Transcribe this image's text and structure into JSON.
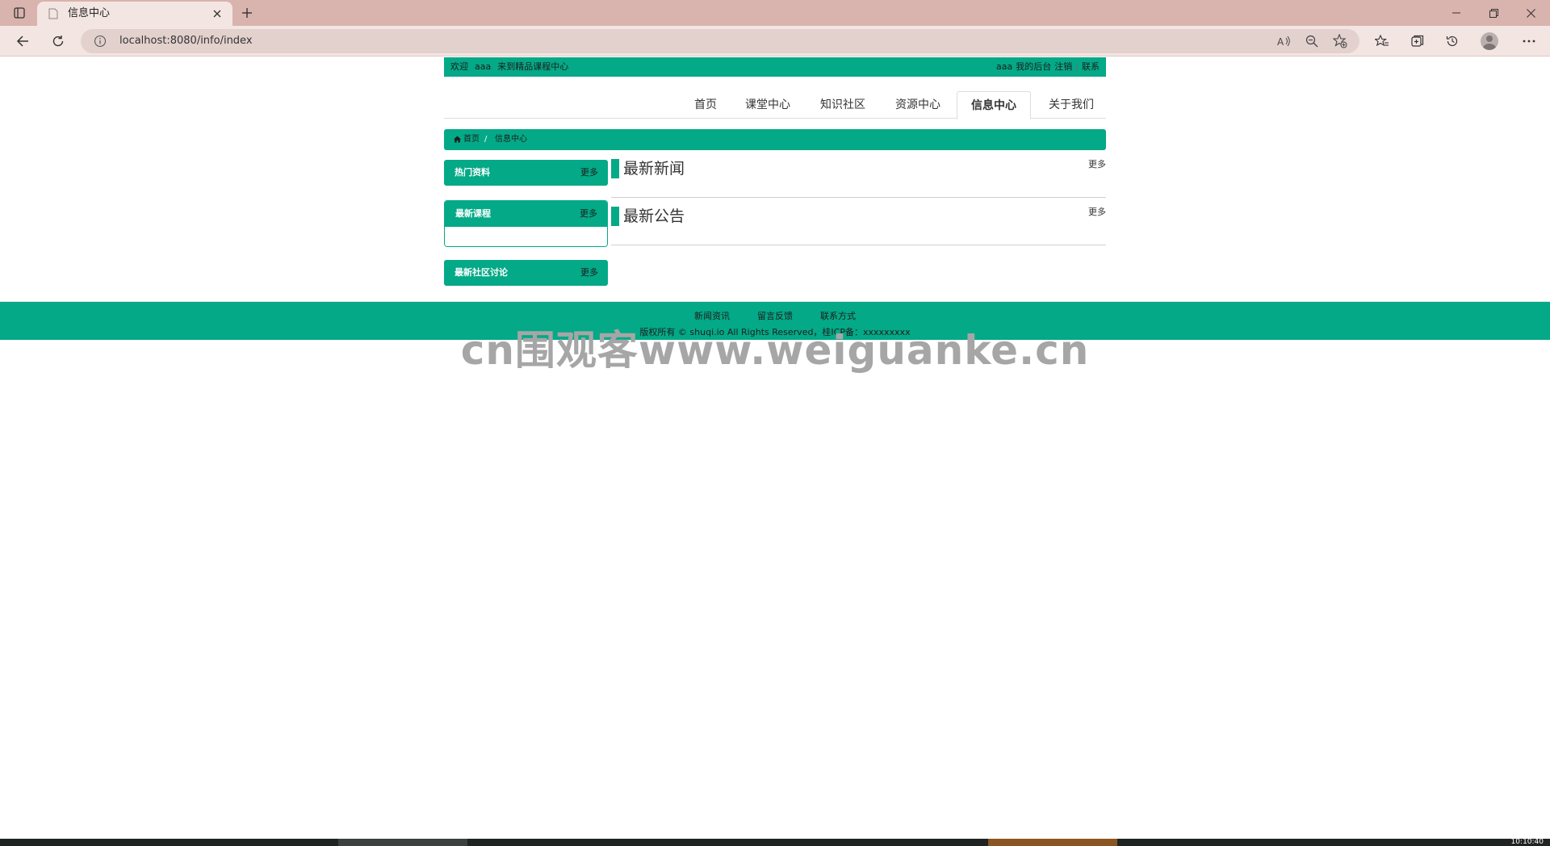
{
  "browser": {
    "tab_title": "信息中心",
    "url": "localhost:8080/info/index"
  },
  "colors": {
    "accent": "#04a987",
    "tabbar": "#d9b3ad",
    "toolbar": "#f3e5e2"
  },
  "topbar": {
    "welcome": "欢迎",
    "username": "aaa",
    "site_greeting": "来到精品课程中心",
    "right_user": "aaa",
    "backend_link": "我的后台",
    "logout_link": "注销",
    "contact_link": "联系"
  },
  "nav": {
    "items": [
      {
        "label": "首页",
        "active": false
      },
      {
        "label": "课堂中心",
        "active": false
      },
      {
        "label": "知识社区",
        "active": false
      },
      {
        "label": "资源中心",
        "active": false
      },
      {
        "label": "信息中心",
        "active": true
      },
      {
        "label": "关于我们",
        "active": false
      }
    ]
  },
  "breadcrumb": {
    "home": "首页",
    "separator": "/",
    "current": "信息中心"
  },
  "sidebar": {
    "panels": [
      {
        "title": "热门资料",
        "more": "更多"
      },
      {
        "title": "最新课程",
        "more": "更多"
      },
      {
        "title": "最新社区讨论",
        "more": "更多"
      }
    ]
  },
  "main": {
    "sections": [
      {
        "title": "最新新闻",
        "more": "更多"
      },
      {
        "title": "最新公告",
        "more": "更多"
      }
    ]
  },
  "footer": {
    "links": [
      "新闻资讯",
      "留言反馈",
      "联系方式"
    ],
    "copyright": "版权所有 © shuqi.io All Rights Reserved，桂ICP备：xxxxxxxxx"
  },
  "watermark": "cn围观客www.weiguanke.cn",
  "taskbar": {
    "clock": "10:10:40"
  }
}
